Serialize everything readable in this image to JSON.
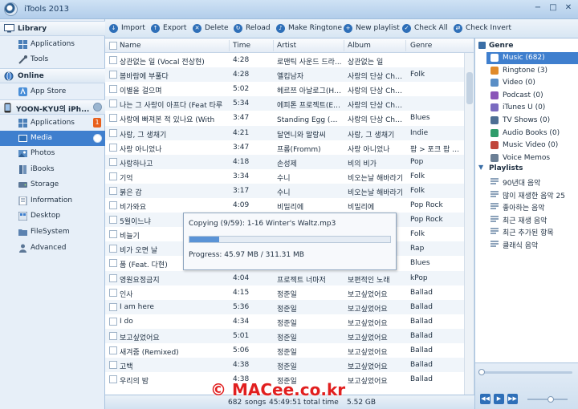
{
  "window": {
    "title": "iTools 2013",
    "controls": [
      "−",
      "□",
      "✕"
    ]
  },
  "sidebar": {
    "library": {
      "label": "Library",
      "items": [
        {
          "label": "Applications",
          "icon": "applications-icon"
        },
        {
          "label": "Tools",
          "icon": "tools-icon"
        }
      ]
    },
    "online": {
      "label": "Online",
      "items": [
        {
          "label": "App Store",
          "icon": "app-store-icon"
        }
      ]
    },
    "device": {
      "label": "YOON-KYU의 iPh...",
      "items": [
        {
          "label": "Applications",
          "icon": "applications-icon",
          "badge": "1"
        },
        {
          "label": "Media",
          "icon": "media-icon",
          "active": true
        },
        {
          "label": "Photos",
          "icon": "photos-icon"
        },
        {
          "label": "iBooks",
          "icon": "ibooks-icon"
        },
        {
          "label": "Storage",
          "icon": "storage-icon"
        },
        {
          "label": "Information",
          "icon": "information-icon"
        },
        {
          "label": "Desktop",
          "icon": "desktop-icon"
        },
        {
          "label": "FileSystem",
          "icon": "filesystem-icon"
        },
        {
          "label": "Advanced",
          "icon": "advanced-icon"
        }
      ]
    }
  },
  "toolbar": [
    {
      "label": "Import",
      "icon": "import-icon"
    },
    {
      "label": "Export",
      "icon": "export-icon"
    },
    {
      "label": "Delete",
      "icon": "delete-icon"
    },
    {
      "label": "Reload",
      "icon": "reload-icon"
    },
    {
      "label": "Make Ringtone",
      "icon": "ringtone-icon"
    },
    {
      "label": "New playlist",
      "icon": "new-playlist-icon"
    },
    {
      "label": "Check All",
      "icon": "check-all-icon"
    },
    {
      "label": "Check Invert",
      "icon": "check-invert-icon"
    }
  ],
  "table": {
    "columns": [
      "Name",
      "Time",
      "Artist",
      "Album",
      "Genre"
    ],
    "rows": [
      [
        "상관없는 일 (Vocal 전상현)",
        "4:28",
        "로맨틱 사운드 드라...",
        "상관없는 일",
        ""
      ],
      [
        "봄바람에 부풀다",
        "4:28",
        "옐킴남자",
        "사랑의 단상 Chap...",
        "Folk"
      ],
      [
        "이별을 걸으며",
        "5:02",
        "헤르쯔 아날로그(Her...",
        "사랑의 단상 Chap...",
        ""
      ],
      [
        "나는 그 사랑이 아프다 (Feat 타루",
        "5:34",
        "에피톤 프로젝트(Epit...",
        "사랑의 단상 Chap...",
        ""
      ],
      [
        "사랑에 빠져본 적 있나요 (With",
        "3:47",
        "Standing Egg (스탠...",
        "사랑의 단상 Chap...",
        "Blues"
      ],
      [
        "사랑, 그 생채기",
        "4:21",
        "달연니와 말랑씨",
        "사랑, 그 생채기",
        "Indie"
      ],
      [
        "사랑 아니었나",
        "3:47",
        "프롬(Fromm)",
        "사랑 아니었나",
        "팝 > 포크 팝 (F..."
      ],
      [
        "사랑하나고",
        "4:18",
        "손성제",
        "비의 비가",
        "Pop"
      ],
      [
        "기억",
        "3:34",
        "수니",
        "비오는날 해바라기",
        "Folk"
      ],
      [
        "붉은 감",
        "3:17",
        "수니",
        "비오는날 해바라기",
        "Folk"
      ],
      [
        "비가와요",
        "4:09",
        "비밀리에",
        "비밀리에",
        "Pop Rock"
      ],
      [
        "5월이느냐",
        "",
        "",
        "",
        "Pop Rock"
      ],
      [
        "비늘기",
        "",
        "",
        "",
        "Folk"
      ],
      [
        "비가 오면 날",
        "",
        "",
        "",
        "Rap"
      ],
      [
        "품 (Feat. 다현)",
        "",
        "",
        "",
        "Blues"
      ],
      [
        "영원요정금지",
        "4:04",
        "프로젝트 너마저",
        "보편적인 노래",
        "kPop"
      ],
      [
        "인사",
        "4:15",
        "정준일",
        "보고싶었어요",
        "Ballad"
      ],
      [
        "I am here",
        "5:36",
        "정준일",
        "보고싶었어요",
        "Ballad"
      ],
      [
        "I do",
        "4:34",
        "정준일",
        "보고싶었어요",
        "Ballad"
      ],
      [
        "보고싶었어요",
        "5:01",
        "정준일",
        "보고싶었어요",
        "Ballad"
      ],
      [
        "새겨줌 (Remixed)",
        "5:06",
        "정준일",
        "보고싶었어요",
        "Ballad"
      ],
      [
        "고백",
        "4:38",
        "정준일",
        "보고싶었어요",
        "Ballad"
      ],
      [
        "우리의 밤",
        "4:38",
        "정준일",
        "보고싶었어요",
        "Ballad"
      ]
    ]
  },
  "status": {
    "count": "682",
    "songs_label": "songs",
    "total_time": "45:49:51",
    "total_time_label": "total time",
    "size": "5.52 GB"
  },
  "genre": {
    "label": "Genre",
    "items": [
      {
        "label": "Music (682)",
        "icon": "music-icon",
        "active": true
      },
      {
        "label": "Ringtone (3)",
        "icon": "ringtone-icon"
      },
      {
        "label": "Video (0)",
        "icon": "video-icon"
      },
      {
        "label": "Podcast (0)",
        "icon": "podcast-icon"
      },
      {
        "label": "iTunes U (0)",
        "icon": "itunes-u-icon"
      },
      {
        "label": "TV Shows (0)",
        "icon": "tv-shows-icon"
      },
      {
        "label": "Audio Books (0)",
        "icon": "audio-books-icon"
      },
      {
        "label": "Music Video (0)",
        "icon": "music-video-icon"
      },
      {
        "label": "Voice Memos",
        "icon": "voice-memos-icon"
      }
    ]
  },
  "playlists": {
    "label": "Playlists",
    "items": [
      "90년대 음악",
      "많이 재생한 음악 25",
      "좋아하는 음악",
      "최근 재생 음악",
      "최근 추가된 항목",
      "클래식 음악"
    ]
  },
  "progress_dialog": {
    "copying": "Copying (9/59): 1-16 Winter's Waltz.mp3",
    "progress_text": "Progress: 45.97 MB / 311.31 MB",
    "fraction": 0.148
  },
  "player": {
    "buttons": [
      "previous-icon",
      "play-icon",
      "next-icon"
    ],
    "button_glyphs": [
      "◀◀",
      "▶",
      "▶▶"
    ]
  },
  "watermark": "© MACee.co.kr",
  "colors": {
    "accent": "#3f7fce",
    "badge": "#e8601c",
    "watermark": "#e11f1f"
  }
}
